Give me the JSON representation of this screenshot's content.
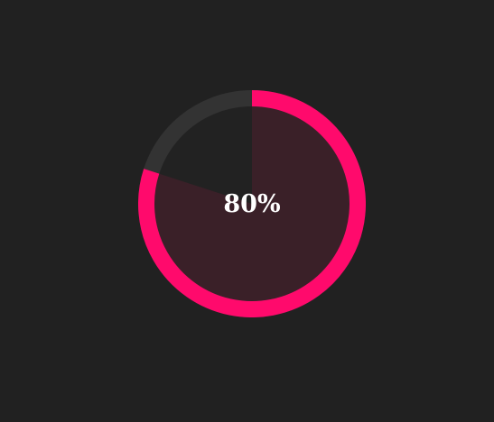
{
  "progress": {
    "label": "80%",
    "value": 0.8
  },
  "colors": {
    "background": "#212121",
    "accent": "#ff0a6c",
    "track": "#333333",
    "fill_inner": "#3a2028",
    "inner_base": "#222222",
    "text": "#ffffff"
  }
}
